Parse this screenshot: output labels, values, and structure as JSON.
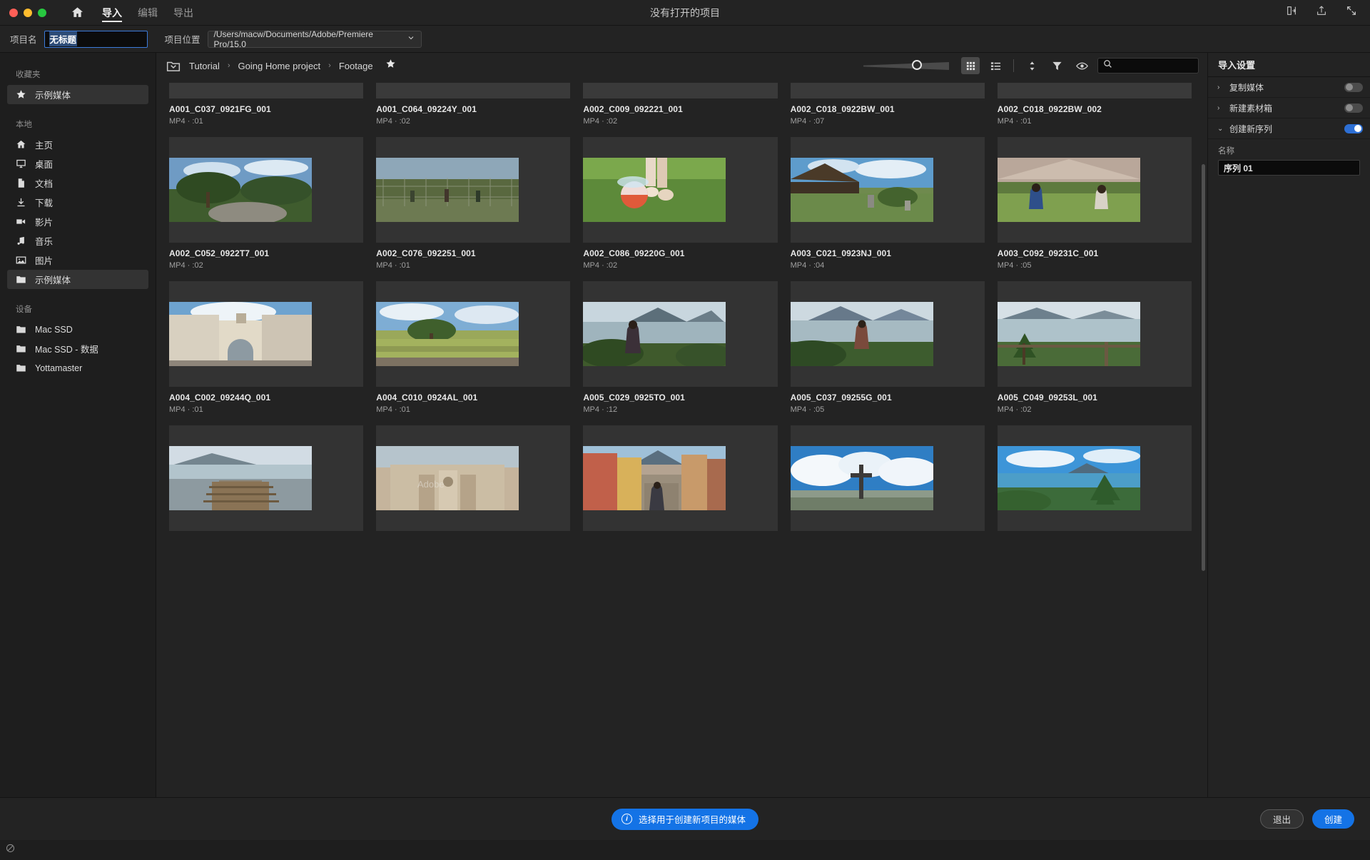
{
  "window": {
    "title": "没有打开的项目",
    "tabs": [
      {
        "label": "导入",
        "active": true
      },
      {
        "label": "编辑",
        "active": false
      },
      {
        "label": "导出",
        "active": false
      }
    ]
  },
  "project_row": {
    "name_label": "项目名",
    "name_value": "无标题",
    "location_label": "项目位置",
    "location_value": "/Users/macw/Documents/Adobe/Premiere Pro/15.0"
  },
  "sidebar": {
    "favorites_header": "收藏夹",
    "favorites": [
      {
        "label": "示例媒体",
        "icon": "star-icon",
        "selected": true
      }
    ],
    "local_header": "本地",
    "local": [
      {
        "label": "主页",
        "icon": "home-icon",
        "selected": false
      },
      {
        "label": "桌面",
        "icon": "desktop-icon",
        "selected": false
      },
      {
        "label": "文档",
        "icon": "document-icon",
        "selected": false
      },
      {
        "label": "下载",
        "icon": "download-icon",
        "selected": false
      },
      {
        "label": "影片",
        "icon": "video-camera-icon",
        "selected": false
      },
      {
        "label": "音乐",
        "icon": "music-note-icon",
        "selected": false
      },
      {
        "label": "图片",
        "icon": "picture-icon",
        "selected": false
      },
      {
        "label": "示例媒体",
        "icon": "folder-icon",
        "selected": true
      }
    ],
    "devices_header": "设备",
    "devices": [
      {
        "label": "Mac SSD",
        "icon": "folder-icon"
      },
      {
        "label": "Mac SSD - 数据",
        "icon": "folder-icon"
      },
      {
        "label": "Yottamaster",
        "icon": "folder-icon"
      }
    ]
  },
  "toolbar": {
    "breadcrumb": [
      "Tutorial",
      "Going Home project",
      "Footage"
    ],
    "separator": "›",
    "zoom_value": 57,
    "view_grid_active": true,
    "search_placeholder": ""
  },
  "media": [
    {
      "name": "A001_C037_0921FG_001",
      "meta": "MP4 · :01",
      "img": "none"
    },
    {
      "name": "A001_C064_09224Y_001",
      "meta": "MP4 · :02",
      "img": "none"
    },
    {
      "name": "A002_C009_092221_001",
      "meta": "MP4 · :02",
      "img": "none"
    },
    {
      "name": "A002_C018_0922BW_001",
      "meta": "MP4 · :07",
      "img": "none"
    },
    {
      "name": "A002_C018_0922BW_002",
      "meta": "MP4 · :01",
      "img": "none"
    },
    {
      "name": "A002_C052_0922T7_001",
      "meta": "MP4 · :02",
      "img": "tree-rock-vista"
    },
    {
      "name": "A002_C076_092251_001",
      "meta": "MP4 · :01",
      "img": "fence-field"
    },
    {
      "name": "A002_C086_09220G_001",
      "meta": "MP4 · :02",
      "img": "ball-feet-grass"
    },
    {
      "name": "A003_C021_0923NJ_001",
      "meta": "MP4 · :04",
      "img": "thatch-hut"
    },
    {
      "name": "A003_C092_09231C_001",
      "meta": "MP4 · :05",
      "img": "kids-hut"
    },
    {
      "name": "A004_C002_09244Q_001",
      "meta": "MP4 · :01",
      "img": "arch-church"
    },
    {
      "name": "A004_C010_0924AL_001",
      "meta": "MP4 · :01",
      "img": "green-field"
    },
    {
      "name": "A005_C029_0925TO_001",
      "meta": "MP4 · :12",
      "img": "woman-lake"
    },
    {
      "name": "A005_C037_09255G_001",
      "meta": "MP4 · :05",
      "img": "lake-volcano"
    },
    {
      "name": "A005_C049_09253L_001",
      "meta": "MP4 · :02",
      "img": "lake-palm"
    },
    {
      "name": "",
      "meta": "",
      "img": "pier-lake"
    },
    {
      "name": "",
      "meta": "",
      "img": "colonial-church"
    },
    {
      "name": "",
      "meta": "",
      "img": "street-volcano"
    },
    {
      "name": "",
      "meta": "",
      "img": "cross-clouds"
    },
    {
      "name": "",
      "meta": "",
      "img": "palm-lake-bright"
    }
  ],
  "import_settings": {
    "title": "导入设置",
    "rows": [
      {
        "label": "复制媒体",
        "arrow": "›",
        "toggle": false
      },
      {
        "label": "新建素材箱",
        "arrow": "›",
        "toggle": false
      },
      {
        "label": "创建新序列",
        "arrow": "⌄",
        "toggle": true
      }
    ],
    "sequence_name_label": "名称",
    "sequence_name_value": "序列 01"
  },
  "bottom": {
    "info_text": "选择用于创建新项目的媒体",
    "info_icon": "info-icon",
    "cancel_label": "退出",
    "create_label": "创建"
  },
  "colors": {
    "accent": "#1473e6",
    "panel": "#232323",
    "sidebar": "#1e1e1e"
  }
}
